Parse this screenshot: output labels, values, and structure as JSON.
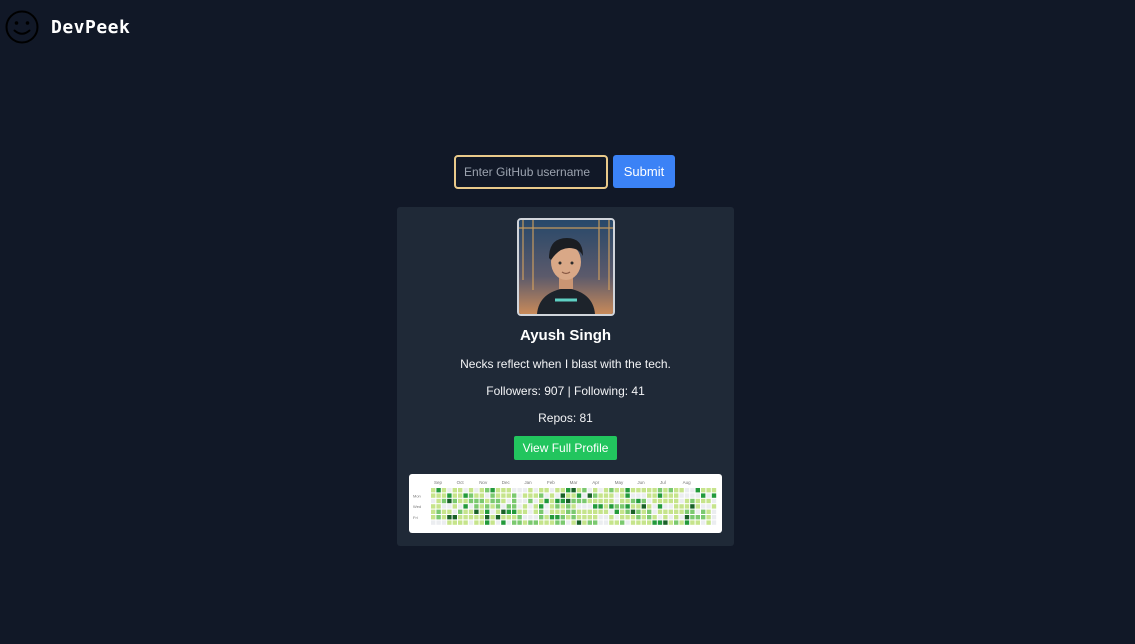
{
  "app": {
    "brand": "DevPeek"
  },
  "search": {
    "placeholder": "Enter GitHub username",
    "value": "",
    "submit_label": "Submit"
  },
  "profile": {
    "name": "Ayush Singh",
    "bio": "Necks reflect when I blast with the tech.",
    "followers_text": "Followers: 907 | Following: 41",
    "repos_text": "Repos: 81",
    "view_button_label": "View Full Profile"
  },
  "contributions": {
    "months": [
      "Sep",
      "Oct",
      "Nov",
      "Dec",
      "Jan",
      "Feb",
      "Mar",
      "Apr",
      "May",
      "Jun",
      "Jul",
      "Aug"
    ],
    "days": [
      "Mon",
      "Wed",
      "Fri"
    ],
    "palette": [
      "#ebedf0",
      "#c6e48b",
      "#7bc96f",
      "#239a3b",
      "#196127"
    ]
  },
  "colors": {
    "background": "#111827",
    "card": "#1f2937",
    "submit": "#3b82f6",
    "profile_button": "#22c55e",
    "input_border": "#e9c98a"
  }
}
